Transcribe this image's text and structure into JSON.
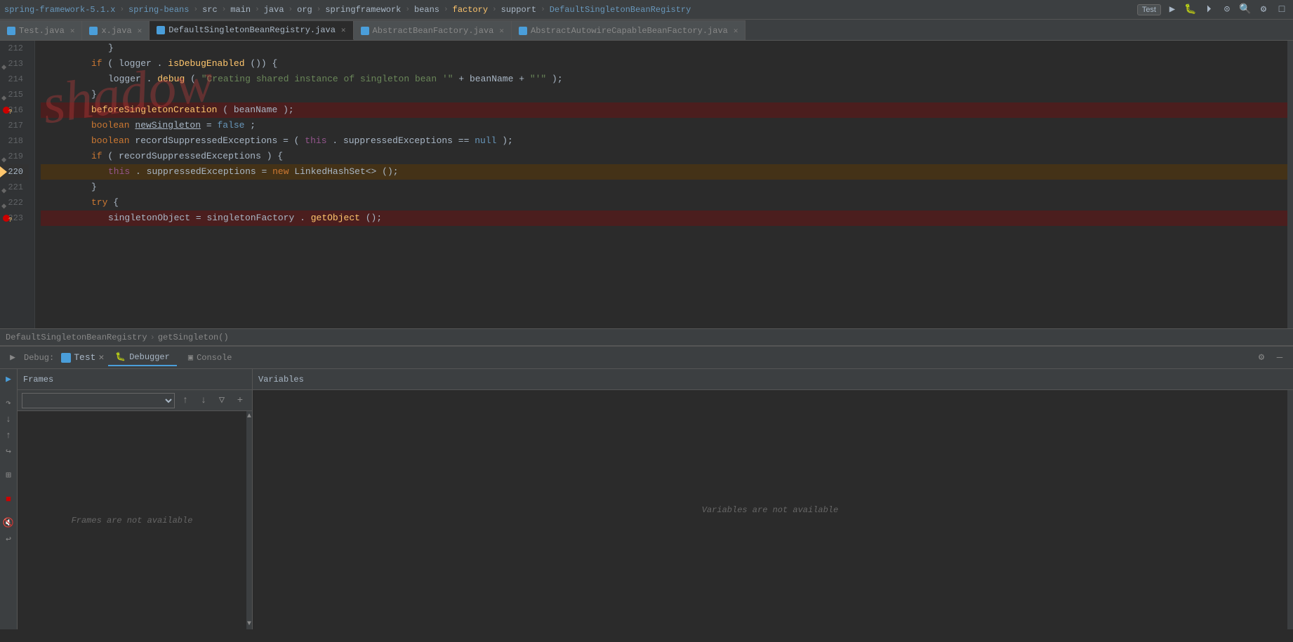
{
  "topbar": {
    "breadcrumb": [
      {
        "label": "spring-framework-5.1.x",
        "type": "project"
      },
      {
        "label": "spring-beans",
        "type": "module"
      },
      {
        "label": "src",
        "type": "folder"
      },
      {
        "label": "main",
        "type": "folder"
      },
      {
        "label": "java",
        "type": "folder"
      },
      {
        "label": "org",
        "type": "package"
      },
      {
        "label": "springframework",
        "type": "package"
      },
      {
        "label": "beans",
        "type": "package"
      },
      {
        "label": "factory",
        "type": "package"
      },
      {
        "label": "support",
        "type": "package"
      },
      {
        "label": "DefaultSingletonBeanRegistry",
        "type": "class"
      }
    ],
    "run_config": "Test",
    "icons": [
      "▶",
      "🐛",
      "▶▶",
      "⏸",
      "🔧",
      "🔍",
      "⊞",
      "□"
    ]
  },
  "tabs": [
    {
      "label": "Test.java",
      "icon_color": "#4a9eda",
      "active": false,
      "has_close": true
    },
    {
      "label": "x.java",
      "icon_color": "#4a9eda",
      "active": false,
      "has_close": true
    },
    {
      "label": "DefaultSingletonBeanRegistry.java",
      "icon_color": "#4a9eda",
      "active": true,
      "has_close": true
    },
    {
      "label": "AbstractBeanFactory.java",
      "icon_color": "#4a9eda",
      "active": false,
      "has_close": true
    },
    {
      "label": "AbstractAutowireCapableBeanFactory.java",
      "icon_color": "#4a9eda",
      "active": false,
      "has_close": true
    }
  ],
  "lines": [
    {
      "num": 212,
      "indent": 3,
      "content": "}"
    },
    {
      "num": 213,
      "indent": 3,
      "content": "if (logger.isDebugEnabled()) {",
      "breakpoint": false
    },
    {
      "num": 214,
      "indent": 4,
      "content": "logger.debug(\"Creating shared instance of singleton bean '\" + beanName + \"'\");"
    },
    {
      "num": 215,
      "indent": 3,
      "content": "}"
    },
    {
      "num": 216,
      "indent": 3,
      "content": "beforeSingletonCreation(beanName);",
      "breakpoint": true,
      "breakpoint_q": true
    },
    {
      "num": 217,
      "indent": 3,
      "content": "boolean newSingleton = false;",
      "underline": "newSingleton"
    },
    {
      "num": 218,
      "indent": 3,
      "content": "boolean recordSuppressedExceptions = (this.suppressedExceptions == null);"
    },
    {
      "num": 219,
      "indent": 3,
      "content": "if (recordSuppressedExceptions) {",
      "has_debug": true
    },
    {
      "num": 220,
      "indent": 4,
      "content": "this.suppressedExceptions = new LinkedHashSet<>();",
      "current": true
    },
    {
      "num": 221,
      "indent": 3,
      "content": "}"
    },
    {
      "num": 222,
      "indent": 3,
      "content": "try {",
      "has_debug": true
    },
    {
      "num": 223,
      "indent": 4,
      "content": "singletonObject = singletonFactory.getObject();",
      "breakpoint": true,
      "breakpoint_q": true
    }
  ],
  "status": {
    "class": "DefaultSingletonBeanRegistry",
    "method": "getSingleton()"
  },
  "debugPanel": {
    "label": "Debug:",
    "session": "Test",
    "tabs": [
      {
        "label": "Debugger",
        "active": true
      },
      {
        "label": "Console",
        "active": false
      }
    ],
    "frames": {
      "header": "Frames",
      "empty_text": "Frames are not available"
    },
    "variables": {
      "header": "Variables",
      "empty_text": "Variables are not available"
    }
  }
}
